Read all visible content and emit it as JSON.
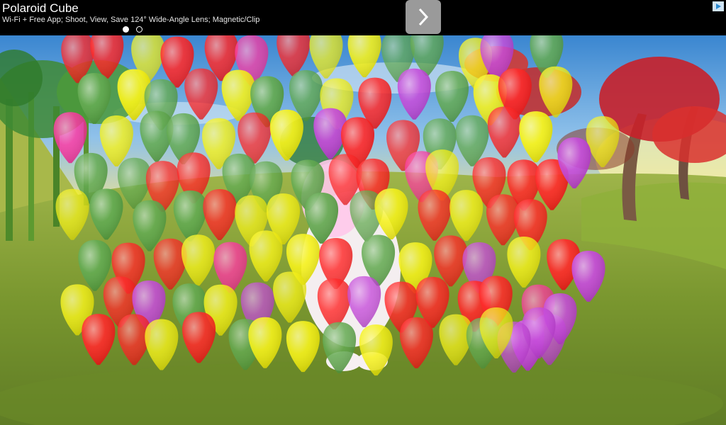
{
  "ad": {
    "title": "Polaroid Cube",
    "subtitle": "Wi-Fi + Free App; Shoot, View, Save 124° Wide-Angle Lens; Magnetic/Clip",
    "next_icon": "chevron-right-icon",
    "adchoices_icon": "adchoices-icon",
    "carousel_dots": [
      true,
      false
    ]
  },
  "scene": {
    "sky_colors": [
      "#3a86d0",
      "#8fc1ea",
      "#f4e48a"
    ],
    "ground_colors": [
      "#8da838",
      "#6d8a2c",
      "#7c9a34"
    ],
    "balloon_colors": {
      "red": "#ff1a1a",
      "yellow": "#f6f20a",
      "green": "#58a444",
      "magenta": "#c23fd8",
      "pink": "#ff2a9c"
    }
  }
}
